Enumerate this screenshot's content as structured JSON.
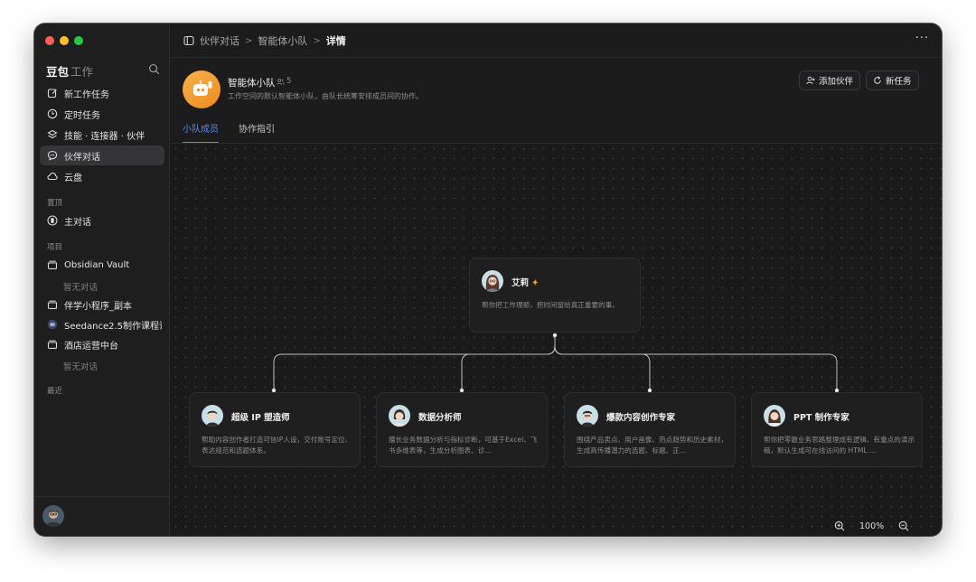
{
  "sidebar": {
    "brand": "豆包",
    "brand_sub": "工作",
    "nav": [
      {
        "label": "新工作任务"
      },
      {
        "label": "定时任务"
      },
      {
        "label": "技能 · 连接器 · 伙伴"
      },
      {
        "label": "伙伴对话",
        "active": true
      },
      {
        "label": "云盘"
      }
    ],
    "section_pinned": "置顶",
    "pinned": [
      {
        "label": "主对话"
      }
    ],
    "section_projects": "项目",
    "projects": [
      {
        "label": "Obsidian Vault",
        "sub": "暂无对话"
      },
      {
        "label": "伴学小程序_副本"
      },
      {
        "label": "Seedance2.5制作课程训"
      },
      {
        "label": "酒店运营中台",
        "sub": "暂无对话"
      }
    ],
    "section_recent": "最近"
  },
  "breadcrumb": {
    "root": "伙伴对话",
    "mid": "智能体小队",
    "current": "详情"
  },
  "team": {
    "name": "智能体小队",
    "count": "5",
    "desc": "工作空间的默认智能体小队，由队长统筹安排成员间的协作。",
    "add_label": "添加伙伴",
    "new_label": "新任务"
  },
  "tabs": [
    "小队成员",
    "协作指引"
  ],
  "leader": {
    "name": "艾莉",
    "desc": "帮你把工作理顺，把时间留给真正重要的事。"
  },
  "members": [
    {
      "name": "超级 IP 塑造师",
      "desc": "帮助内容创作者打造可信IP人设，交付账号定位、表达规范和选题体系。"
    },
    {
      "name": "数据分析师",
      "desc": "擅长业务数据分析与指标诊断，可基于Excel、飞书多维表等，生成分析图表、诊..."
    },
    {
      "name": "爆款内容创作专家",
      "desc": "围绕产品卖点、用户画像、热点趋势和历史素材，生成高传播潜力的选题、标题、正..."
    },
    {
      "name": "PPT 制作专家",
      "desc": "帮你把零散业务思路整理成有逻辑、有重点的演示稿，默认生成可在线访问的 HTML ..."
    }
  ],
  "zoom": {
    "level": "100%"
  },
  "colors": {
    "accent": "#4d8bff",
    "bg": "#1b1b1c",
    "logo": "#f29a2e"
  }
}
